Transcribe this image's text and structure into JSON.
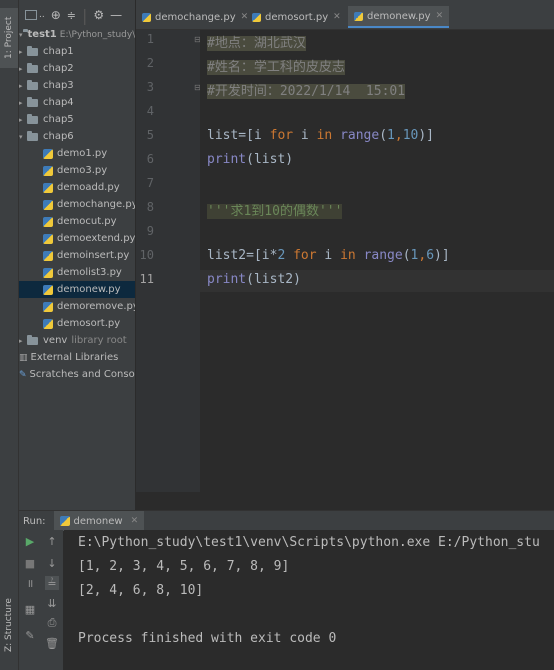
{
  "left_strip": {
    "project_tab": "1: Project",
    "structure_tab": "Z: Structure"
  },
  "project": {
    "toolbar_label": "..",
    "root": {
      "name": "test1",
      "path": "E:\\Python_study\\t"
    },
    "folders": [
      "chap1",
      "chap2",
      "chap3",
      "chap4",
      "chap5",
      "chap6"
    ],
    "files": [
      "demo1.py",
      "demo3.py",
      "demoadd.py",
      "demochange.py",
      "democut.py",
      "demoextend.py",
      "demoinsert.py",
      "demolist3.py",
      "demonew.py",
      "demoremove.py",
      "demosort.py"
    ],
    "selected_file": "demonew.py",
    "venv": {
      "name": "venv",
      "note": "library root"
    },
    "external": "External Libraries",
    "scratches": "Scratches and Consoles"
  },
  "tabs": [
    {
      "label": "demochange.py"
    },
    {
      "label": "demosort.py"
    },
    {
      "label": "demonew.py"
    }
  ],
  "editor": {
    "line_numbers": [
      "1",
      "2",
      "3",
      "4",
      "5",
      "6",
      "7",
      "8",
      "9",
      "10",
      "11"
    ],
    "lines": {
      "l1": "#地点：湖北武汉",
      "l2": "#姓名：学工科的皮皮志",
      "l3": "#开发时间：2022/1/14  15:01",
      "l5_a": "list=[i ",
      "l5_for": "for",
      "l5_b": " i ",
      "l5_in": "in",
      "l5_c": " ",
      "l5_range": "range",
      "l5_d": "(",
      "l5_n1": "1",
      "l5_e": ",",
      "l5_n2": "10",
      "l5_f": ")]",
      "l6_fn": "print",
      "l6_b": "(list)",
      "l8": "'''求1到10的偶数'''",
      "l10_a": "list2=[i*",
      "l10_n0": "2",
      "l10_b": " ",
      "l10_for": "for",
      "l10_c": " i ",
      "l10_in": "in",
      "l10_d": " ",
      "l10_range": "range",
      "l10_e": "(",
      "l10_n1": "1",
      "l10_f": ",",
      "l10_n2": "6",
      "l10_g": ")]",
      "l11_fn": "print",
      "l11_b": "(list2)"
    }
  },
  "run": {
    "label": "Run:",
    "tab": "demonew",
    "output": [
      "E:\\Python_study\\test1\\venv\\Scripts\\python.exe E:/Python_stu",
      "[1, 2, 3, 4, 5, 6, 7, 8, 9]",
      "[2, 4, 6, 8, 10]",
      "",
      "Process finished with exit code 0"
    ]
  }
}
